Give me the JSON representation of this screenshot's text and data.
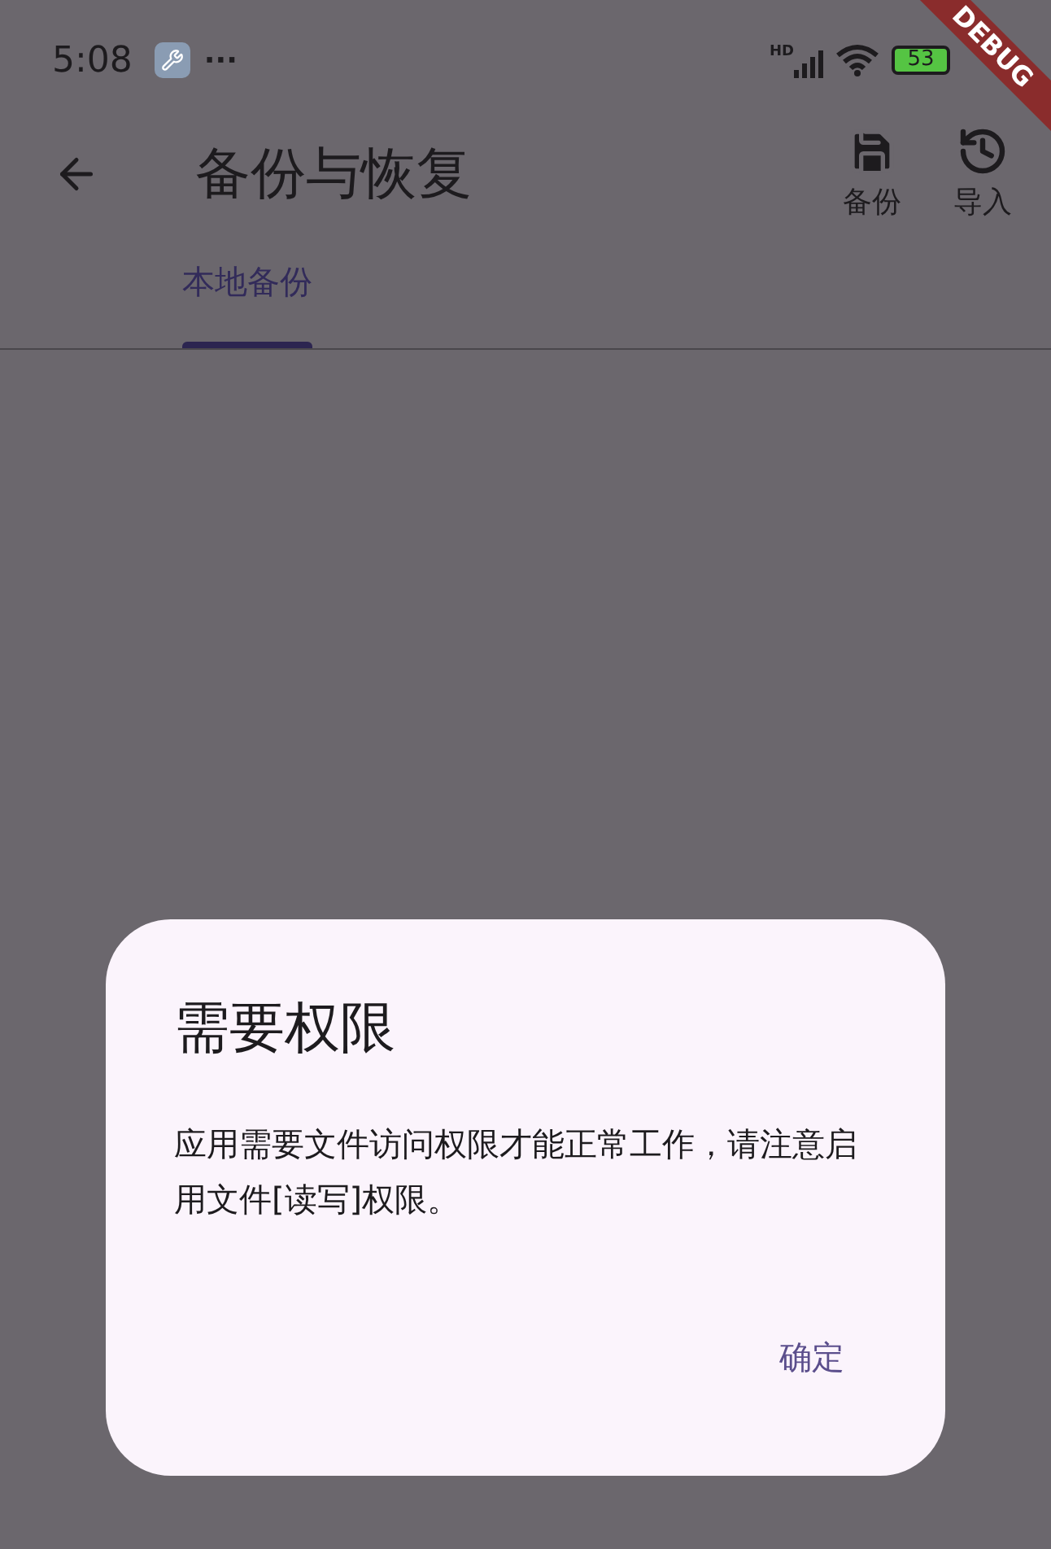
{
  "status_bar": {
    "time": "5:08",
    "more": "···",
    "network": "HD",
    "battery": "53"
  },
  "debug_banner": "DEBUG",
  "app_bar": {
    "title": "备份与恢复",
    "actions": [
      {
        "kind": "save",
        "label": "备份"
      },
      {
        "kind": "history",
        "label": "导入"
      }
    ]
  },
  "tabs": [
    {
      "label": "本地备份",
      "selected": true
    }
  ],
  "dialog": {
    "title": "需要权限",
    "message": "应用需要文件访问权限才能正常工作，请注意启用文件[读写]权限。",
    "buttons": [
      "确定"
    ]
  }
}
